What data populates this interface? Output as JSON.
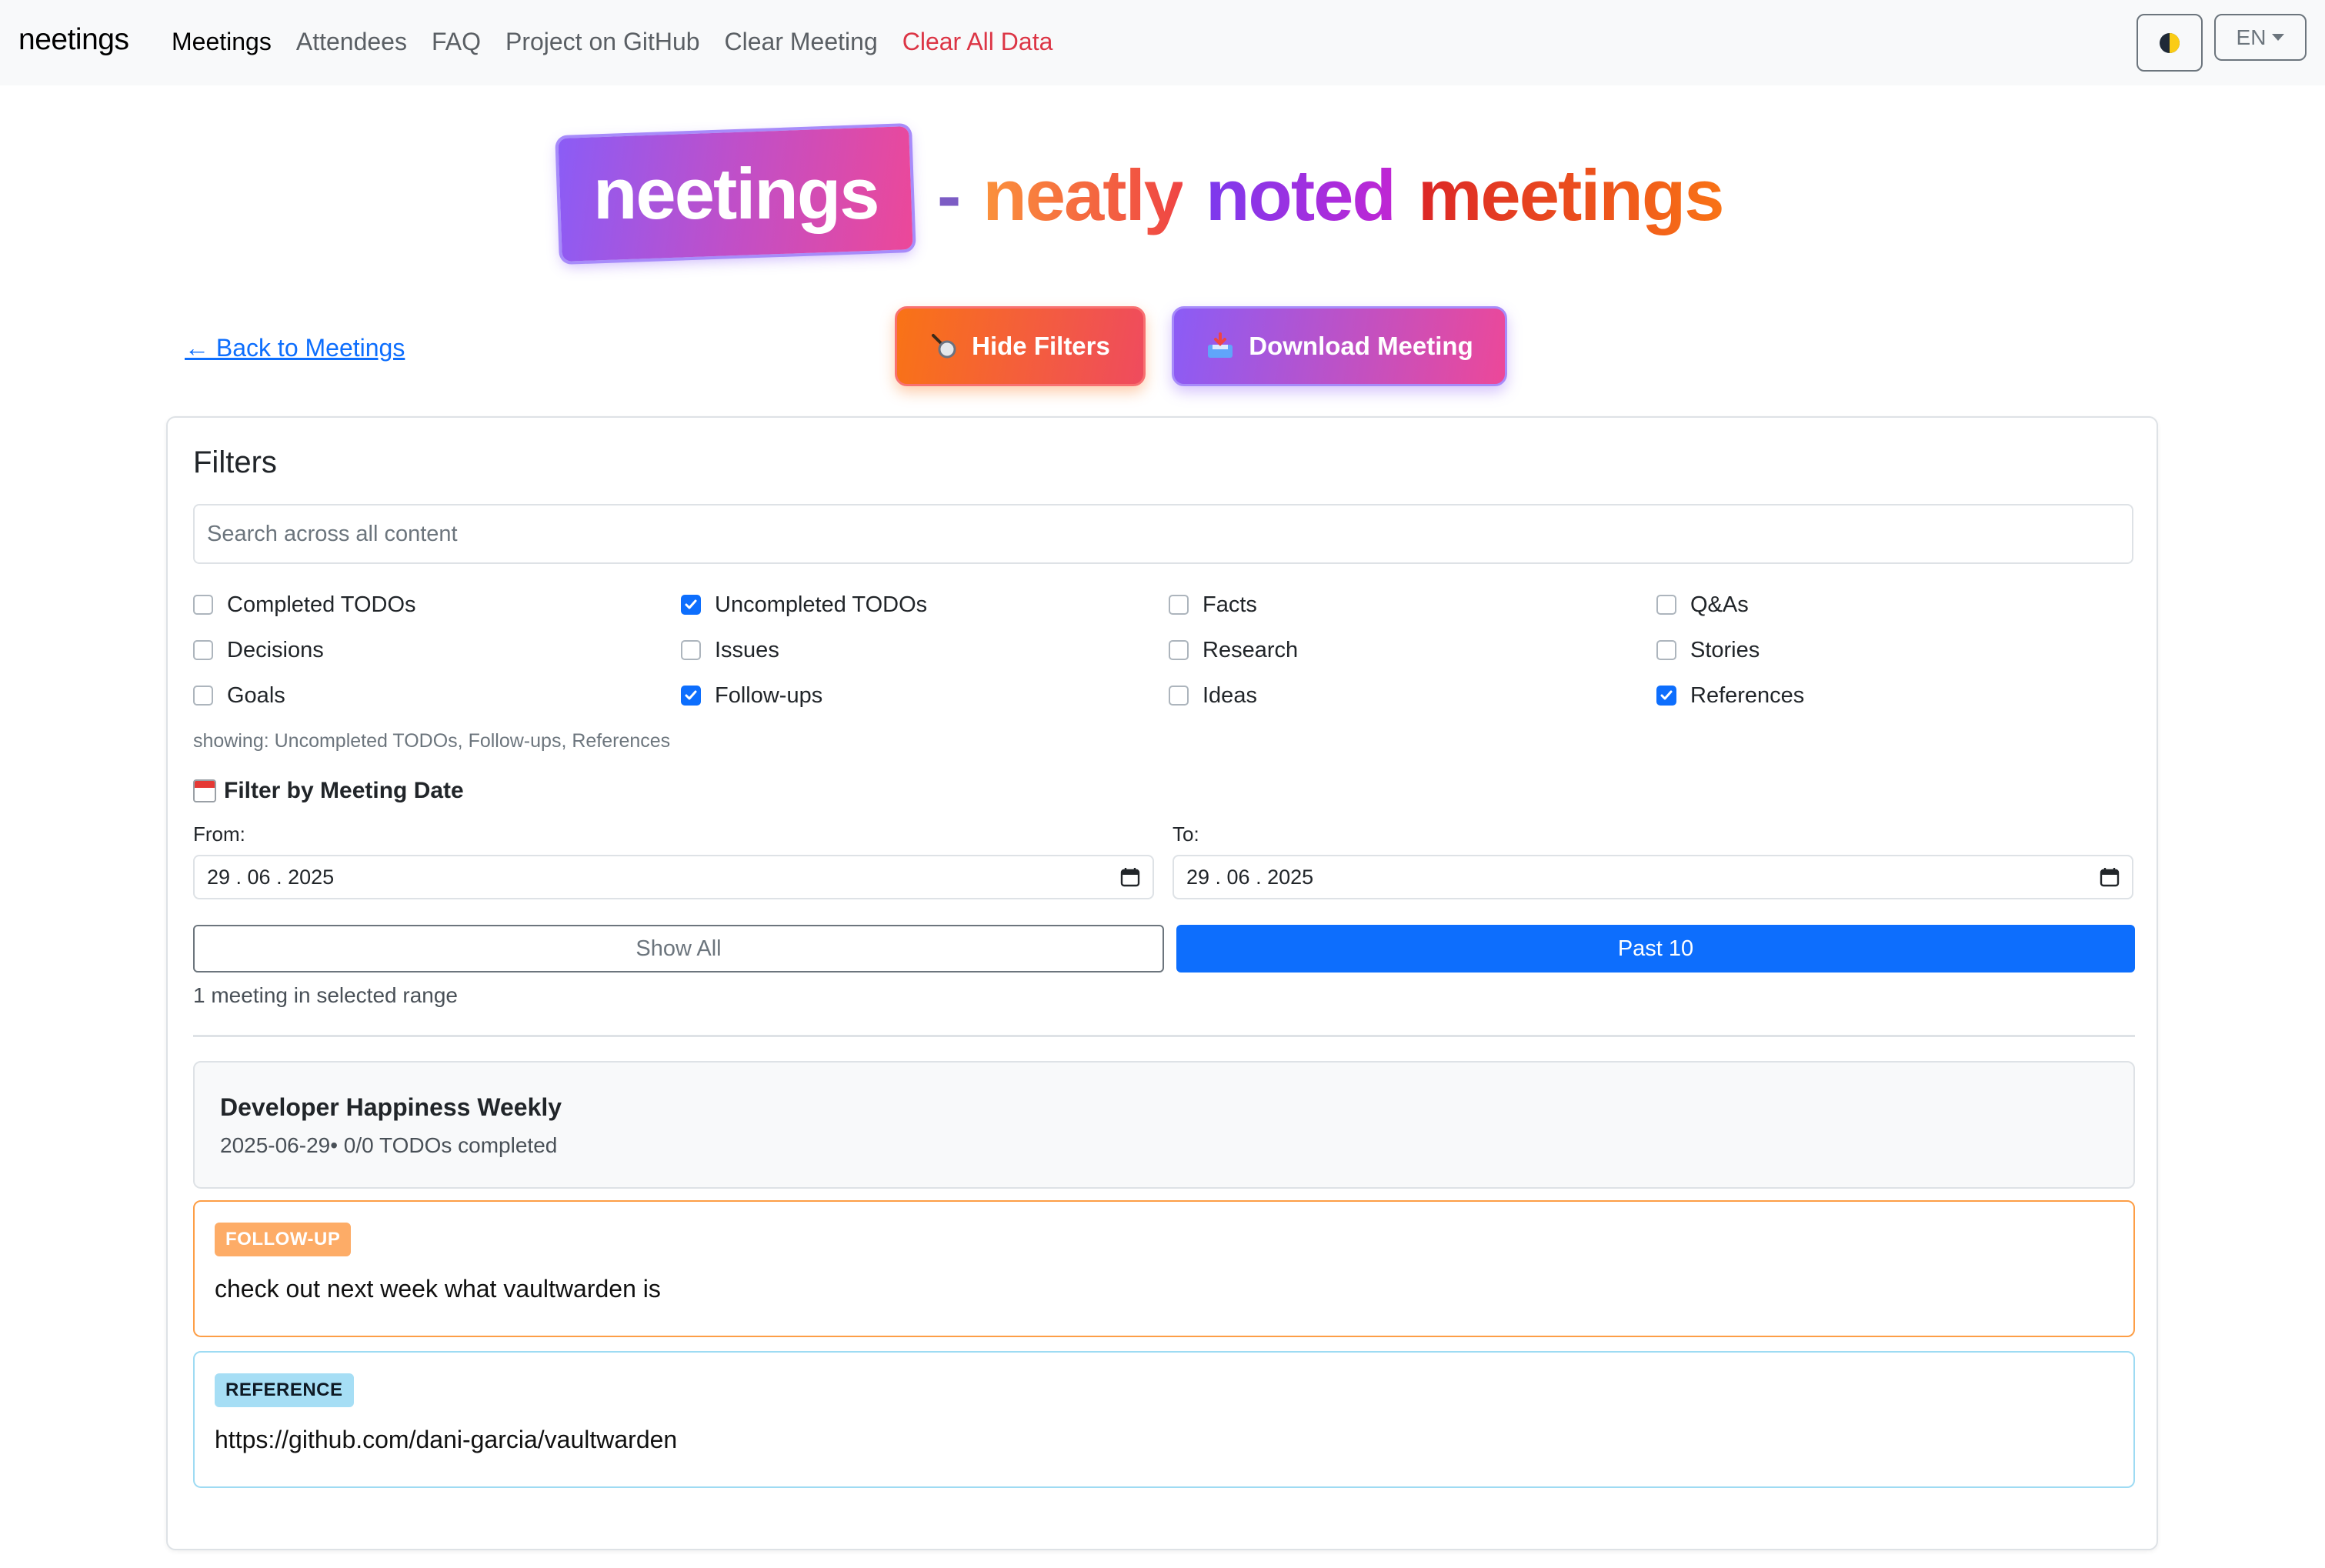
{
  "nav": {
    "brand": "neetings",
    "links": [
      "Meetings",
      "Attendees",
      "FAQ",
      "Project on GitHub",
      "Clear Meeting",
      "Clear All Data"
    ],
    "language": "EN"
  },
  "hero": {
    "logo_text": "neetings",
    "dash": "-",
    "tagline_words": [
      "neatly",
      "noted",
      "meetings"
    ]
  },
  "actions": {
    "back_link": "← Back to Meetings",
    "hide_filters": "Hide Filters",
    "download_meeting": "Download Meeting"
  },
  "filters": {
    "title": "Filters",
    "search_placeholder": "Search across all content",
    "checkboxes": [
      {
        "label": "Completed TODOs",
        "checked": false
      },
      {
        "label": "Uncompleted TODOs",
        "checked": true
      },
      {
        "label": "Facts",
        "checked": false
      },
      {
        "label": "Q&As",
        "checked": false
      },
      {
        "label": "Decisions",
        "checked": false
      },
      {
        "label": "Issues",
        "checked": false
      },
      {
        "label": "Research",
        "checked": false
      },
      {
        "label": "Stories",
        "checked": false
      },
      {
        "label": "Goals",
        "checked": false
      },
      {
        "label": "Follow-ups",
        "checked": true
      },
      {
        "label": "Ideas",
        "checked": false
      },
      {
        "label": "References",
        "checked": true
      }
    ],
    "showing": "showing: Uncompleted TODOs, Follow-ups, References",
    "date_heading": "Filter by Meeting Date",
    "from_label": "From:",
    "to_label": "To:",
    "from_value": "29 . 06 . 2025",
    "to_value": "29 . 06 . 2025",
    "show_all": "Show All",
    "past_10": "Past 10",
    "range_text": "1 meeting in selected range"
  },
  "meeting": {
    "title": "Developer Happiness Weekly",
    "subtitle": "2025-06-29• 0/0 TODOs completed"
  },
  "items": [
    {
      "badge": "FOLLOW-UP",
      "text": "check out next week what vaultwarden is"
    },
    {
      "badge": "REFERENCE",
      "text": "https://github.com/dani-garcia/vaultwarden"
    }
  ],
  "colors": {
    "primary": "#0d6efd",
    "danger": "#dc3545",
    "followup_border": "#fd9e46",
    "reference_border": "#9edbf3"
  }
}
